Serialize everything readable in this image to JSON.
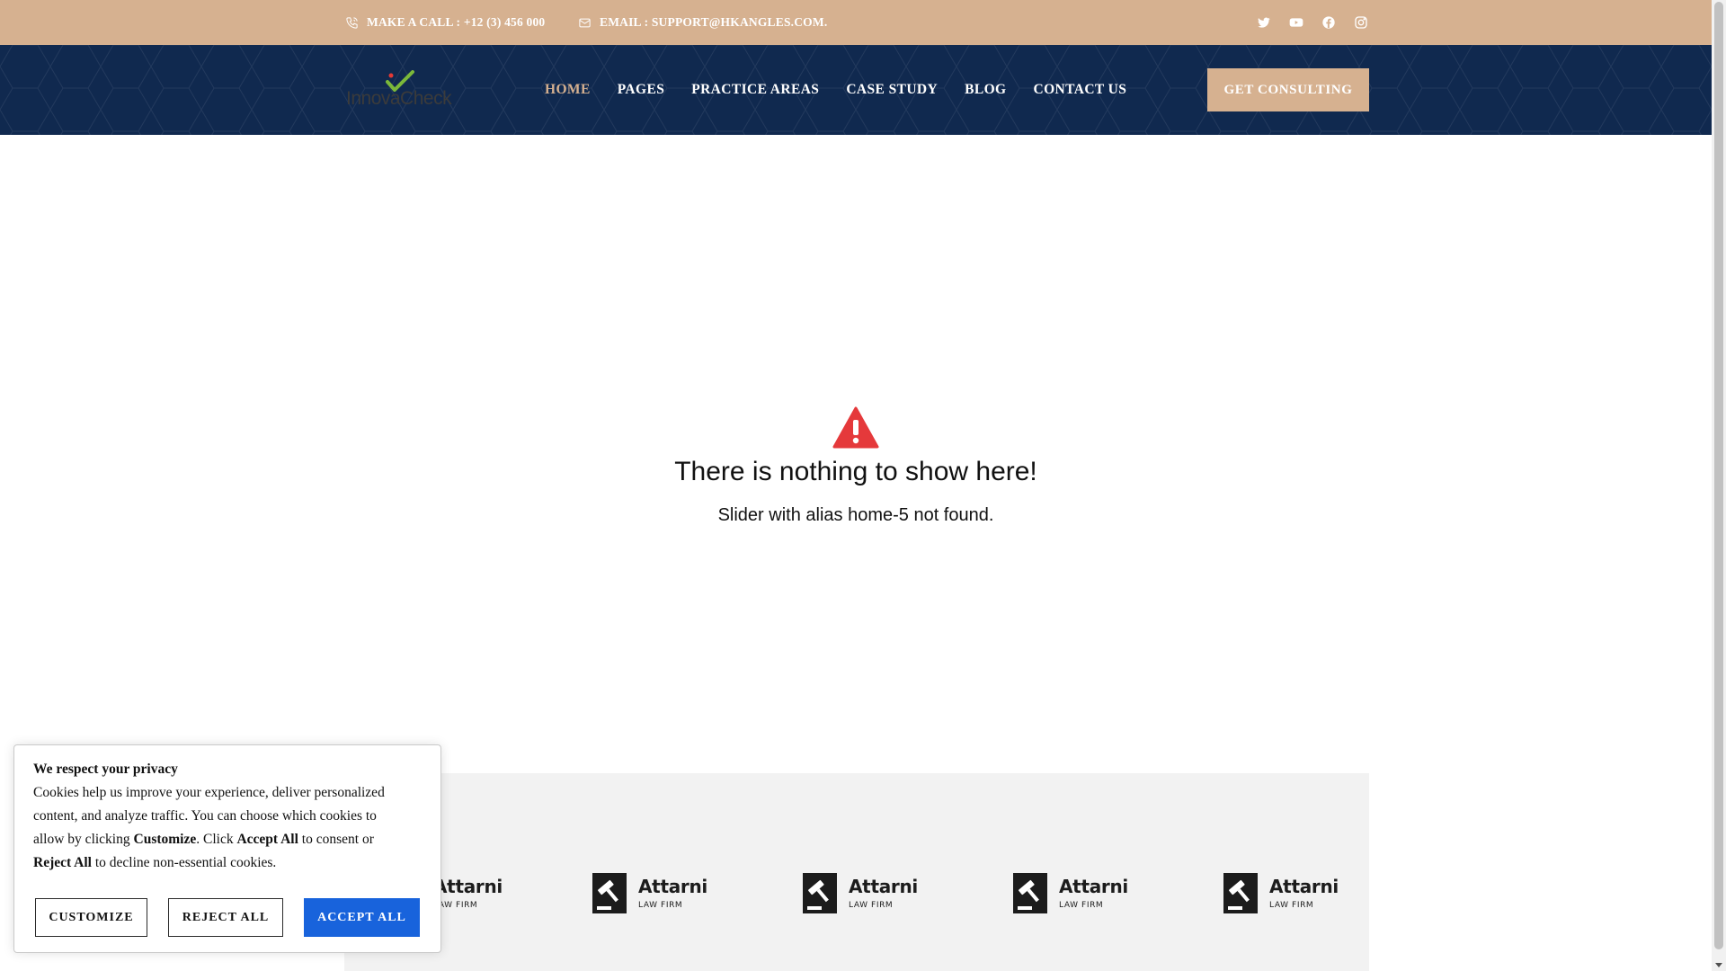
{
  "topbar": {
    "phone": "MAKE A CALL : +12 (3) 456 000",
    "email": "EMAIL : SUPPORT@HKANGLES.COM.",
    "socials": [
      "twitter-icon",
      "youtube-icon",
      "facebook-icon",
      "instagram-icon"
    ],
    "bg_color": "#d6b190"
  },
  "header": {
    "logo_text": "InnovaCheck",
    "nav": [
      {
        "label": "HOME",
        "active": true
      },
      {
        "label": "PAGES",
        "active": false
      },
      {
        "label": "PRACTICE AREAS",
        "active": false
      },
      {
        "label": "CASE STUDY",
        "active": false
      },
      {
        "label": "BLOG",
        "active": false
      },
      {
        "label": "CONTACT US",
        "active": false
      }
    ],
    "cta_label": "GET CONSULTING",
    "bg_color": "#10294f",
    "accent_color": "#d6b190"
  },
  "slider_notice": {
    "icon": "warning-triangle-icon",
    "title": "There is nothing to show here!",
    "message": "Slider with alias home-5 not found.",
    "icon_color": "#e5393b"
  },
  "brands": [
    {
      "name": "Attarni",
      "sub": "LAW FIRM"
    },
    {
      "name": "Attarni",
      "sub": "LAW FIRM"
    },
    {
      "name": "Attarni",
      "sub": "LAW FIRM"
    },
    {
      "name": "Attarni",
      "sub": "LAW FIRM"
    },
    {
      "name": "Attarni",
      "sub": "LAW FIRM"
    }
  ],
  "cookie": {
    "title": "We respect your privacy",
    "text_1": "Cookies help us improve your experience, deliver personalized content, and analyze traffic. You can choose which cookies to allow by clicking ",
    "customize_word": "Customize",
    "text_2": ". Click ",
    "accept_word": "Accept All",
    "text_3": " to consent or ",
    "reject_word": "Reject All",
    "text_4": " to decline non-essential cookies.",
    "customize_label": "CUSTOMIZE",
    "reject_label": "REJECT ALL",
    "accept_label": "ACCEPT ALL",
    "accept_color": "#1863dc"
  }
}
